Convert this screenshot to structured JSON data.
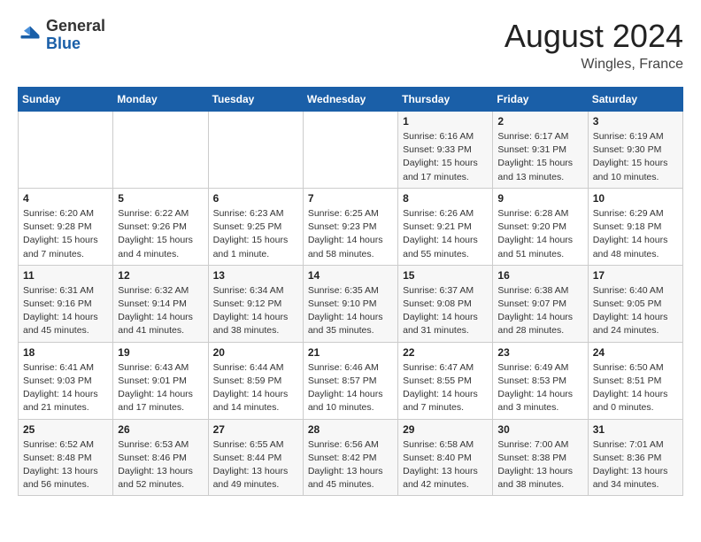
{
  "header": {
    "logo_general": "General",
    "logo_blue": "Blue",
    "title": "August 2024",
    "location": "Wingles, France"
  },
  "weekdays": [
    "Sunday",
    "Monday",
    "Tuesday",
    "Wednesday",
    "Thursday",
    "Friday",
    "Saturday"
  ],
  "weeks": [
    [
      {
        "day": "",
        "info": ""
      },
      {
        "day": "",
        "info": ""
      },
      {
        "day": "",
        "info": ""
      },
      {
        "day": "",
        "info": ""
      },
      {
        "day": "1",
        "info": "Sunrise: 6:16 AM\nSunset: 9:33 PM\nDaylight: 15 hours and 17 minutes."
      },
      {
        "day": "2",
        "info": "Sunrise: 6:17 AM\nSunset: 9:31 PM\nDaylight: 15 hours and 13 minutes."
      },
      {
        "day": "3",
        "info": "Sunrise: 6:19 AM\nSunset: 9:30 PM\nDaylight: 15 hours and 10 minutes."
      }
    ],
    [
      {
        "day": "4",
        "info": "Sunrise: 6:20 AM\nSunset: 9:28 PM\nDaylight: 15 hours and 7 minutes."
      },
      {
        "day": "5",
        "info": "Sunrise: 6:22 AM\nSunset: 9:26 PM\nDaylight: 15 hours and 4 minutes."
      },
      {
        "day": "6",
        "info": "Sunrise: 6:23 AM\nSunset: 9:25 PM\nDaylight: 15 hours and 1 minute."
      },
      {
        "day": "7",
        "info": "Sunrise: 6:25 AM\nSunset: 9:23 PM\nDaylight: 14 hours and 58 minutes."
      },
      {
        "day": "8",
        "info": "Sunrise: 6:26 AM\nSunset: 9:21 PM\nDaylight: 14 hours and 55 minutes."
      },
      {
        "day": "9",
        "info": "Sunrise: 6:28 AM\nSunset: 9:20 PM\nDaylight: 14 hours and 51 minutes."
      },
      {
        "day": "10",
        "info": "Sunrise: 6:29 AM\nSunset: 9:18 PM\nDaylight: 14 hours and 48 minutes."
      }
    ],
    [
      {
        "day": "11",
        "info": "Sunrise: 6:31 AM\nSunset: 9:16 PM\nDaylight: 14 hours and 45 minutes."
      },
      {
        "day": "12",
        "info": "Sunrise: 6:32 AM\nSunset: 9:14 PM\nDaylight: 14 hours and 41 minutes."
      },
      {
        "day": "13",
        "info": "Sunrise: 6:34 AM\nSunset: 9:12 PM\nDaylight: 14 hours and 38 minutes."
      },
      {
        "day": "14",
        "info": "Sunrise: 6:35 AM\nSunset: 9:10 PM\nDaylight: 14 hours and 35 minutes."
      },
      {
        "day": "15",
        "info": "Sunrise: 6:37 AM\nSunset: 9:08 PM\nDaylight: 14 hours and 31 minutes."
      },
      {
        "day": "16",
        "info": "Sunrise: 6:38 AM\nSunset: 9:07 PM\nDaylight: 14 hours and 28 minutes."
      },
      {
        "day": "17",
        "info": "Sunrise: 6:40 AM\nSunset: 9:05 PM\nDaylight: 14 hours and 24 minutes."
      }
    ],
    [
      {
        "day": "18",
        "info": "Sunrise: 6:41 AM\nSunset: 9:03 PM\nDaylight: 14 hours and 21 minutes."
      },
      {
        "day": "19",
        "info": "Sunrise: 6:43 AM\nSunset: 9:01 PM\nDaylight: 14 hours and 17 minutes."
      },
      {
        "day": "20",
        "info": "Sunrise: 6:44 AM\nSunset: 8:59 PM\nDaylight: 14 hours and 14 minutes."
      },
      {
        "day": "21",
        "info": "Sunrise: 6:46 AM\nSunset: 8:57 PM\nDaylight: 14 hours and 10 minutes."
      },
      {
        "day": "22",
        "info": "Sunrise: 6:47 AM\nSunset: 8:55 PM\nDaylight: 14 hours and 7 minutes."
      },
      {
        "day": "23",
        "info": "Sunrise: 6:49 AM\nSunset: 8:53 PM\nDaylight: 14 hours and 3 minutes."
      },
      {
        "day": "24",
        "info": "Sunrise: 6:50 AM\nSunset: 8:51 PM\nDaylight: 14 hours and 0 minutes."
      }
    ],
    [
      {
        "day": "25",
        "info": "Sunrise: 6:52 AM\nSunset: 8:48 PM\nDaylight: 13 hours and 56 minutes."
      },
      {
        "day": "26",
        "info": "Sunrise: 6:53 AM\nSunset: 8:46 PM\nDaylight: 13 hours and 52 minutes."
      },
      {
        "day": "27",
        "info": "Sunrise: 6:55 AM\nSunset: 8:44 PM\nDaylight: 13 hours and 49 minutes."
      },
      {
        "day": "28",
        "info": "Sunrise: 6:56 AM\nSunset: 8:42 PM\nDaylight: 13 hours and 45 minutes."
      },
      {
        "day": "29",
        "info": "Sunrise: 6:58 AM\nSunset: 8:40 PM\nDaylight: 13 hours and 42 minutes."
      },
      {
        "day": "30",
        "info": "Sunrise: 7:00 AM\nSunset: 8:38 PM\nDaylight: 13 hours and 38 minutes."
      },
      {
        "day": "31",
        "info": "Sunrise: 7:01 AM\nSunset: 8:36 PM\nDaylight: 13 hours and 34 minutes."
      }
    ]
  ]
}
